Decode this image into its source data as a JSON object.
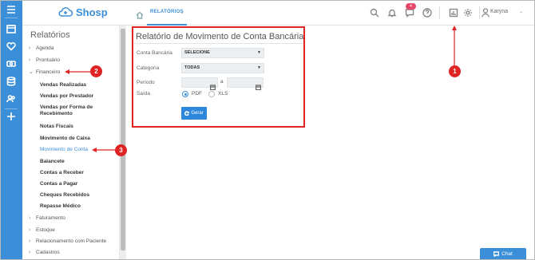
{
  "app": {
    "logo_text": "Shosp",
    "brand_color": "#3b8fd8"
  },
  "topbar": {
    "breadcrumb": "RELATÓRIOS",
    "notification_badge": "4",
    "user_name": "Karyna",
    "icons": [
      "search-icon",
      "bell-icon",
      "chat-bubble-icon",
      "help-icon",
      "report-icon",
      "gear-icon",
      "user-icon"
    ]
  },
  "rail_icons": [
    "menu-icon",
    "agenda-icon",
    "heart-icon",
    "money-icon",
    "database-icon",
    "users-icon",
    "plus-icon"
  ],
  "sidebar": {
    "title": "Relatórios",
    "sections": [
      {
        "label": "Agenda",
        "expanded": false
      },
      {
        "label": "Prontuário",
        "expanded": false
      },
      {
        "label": "Financeiro",
        "expanded": true
      },
      {
        "label": "Faturamento",
        "expanded": false
      },
      {
        "label": "Estoque",
        "expanded": false
      },
      {
        "label": "Relacionamento com Paciente",
        "expanded": false
      },
      {
        "label": "Cadastros",
        "expanded": false
      }
    ],
    "financeiro_items": [
      "Vendas Realizadas",
      "Vendas por Prestador",
      "Vendas por Forma de Recebimento",
      "Notas Fiscais",
      "Movimento de Caixa",
      "Movimento de Conta",
      "Balancete",
      "Contas a Receber",
      "Contas a Pagar",
      "Cheques Recebidos",
      "Repasse Médico"
    ],
    "active_item": "Movimento de Conta"
  },
  "form": {
    "title": "Relatório de Movimento de Conta Bancária",
    "fields": {
      "conta_label": "Conta Bancária",
      "conta_value": "SELECIONE",
      "categoria_label": "Categoria",
      "categoria_value": "TODAS",
      "periodo_label": "Período",
      "periodo_separator": "a",
      "saida_label": "Saída",
      "saida_options": [
        "PDF",
        "XLS"
      ],
      "saida_selected": "PDF"
    },
    "submit_label": "Gerar"
  },
  "annotations": {
    "step1": "1",
    "step2": "2",
    "step3": "3",
    "color": "#e02424"
  },
  "chat_button": "Chat"
}
